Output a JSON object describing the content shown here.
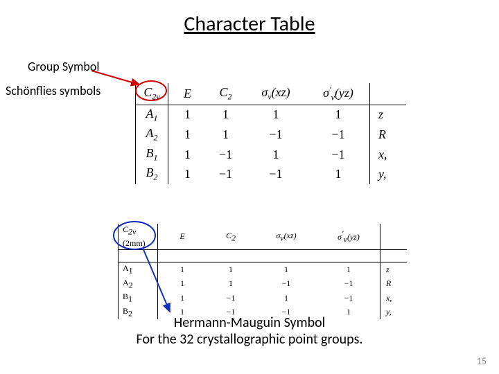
{
  "title": "Character Table",
  "labels": {
    "group_symbol": "Group Symbol",
    "schonflies": "Schönflies symbols",
    "hermann_line1": "Hermann-Mauguin Symbol",
    "hermann_line2": "For the 32 crystallographic point groups."
  },
  "top_table": {
    "header": {
      "group": "C",
      "group_sub": "2v",
      "ops": [
        "E",
        "C",
        "σ",
        "σ"
      ],
      "op_subs": [
        "",
        "2",
        "v",
        "v"
      ],
      "op_sups": [
        "",
        "",
        "",
        "′"
      ],
      "op_paren": [
        "",
        "",
        "(xz)",
        "(yz)"
      ]
    },
    "rows": [
      {
        "irrep": "A",
        "irrep_sub": "1",
        "v": [
          "1",
          "1",
          "1",
          "1"
        ],
        "basis": "z"
      },
      {
        "irrep": "A",
        "irrep_sub": "2",
        "v": [
          "1",
          "1",
          "−1",
          "−1"
        ],
        "basis": "R"
      },
      {
        "irrep": "B",
        "irrep_sub": "1",
        "v": [
          "1",
          "−1",
          "1",
          "−1"
        ],
        "basis": "x,"
      },
      {
        "irrep": "B",
        "irrep_sub": "2",
        "v": [
          "1",
          "−1",
          "−1",
          "1"
        ],
        "basis": "y,"
      }
    ]
  },
  "bottom_table": {
    "header": {
      "group1": "C",
      "group1_sub": "2v",
      "group2": "(2mm)",
      "ops": [
        "E",
        "C",
        "σ",
        "σ"
      ],
      "op_subs": [
        "",
        "2",
        "v",
        "v"
      ],
      "op_sups": [
        "",
        "",
        "",
        "′"
      ],
      "op_paren": [
        "",
        "",
        "(xz)",
        "(yz)"
      ]
    },
    "rows": [
      {
        "irrep": "A",
        "irrep_sub": "1",
        "v": [
          "1",
          "1",
          "1",
          "1"
        ],
        "basis": "z"
      },
      {
        "irrep": "A",
        "irrep_sub": "2",
        "v": [
          "1",
          "1",
          "−1",
          "−1"
        ],
        "basis": "R"
      },
      {
        "irrep": "B",
        "irrep_sub": "1",
        "v": [
          "1",
          "−1",
          "1",
          "−1"
        ],
        "basis": "x, "
      },
      {
        "irrep": "B",
        "irrep_sub": "2",
        "v": [
          "1",
          "−1",
          "−1",
          "1"
        ],
        "basis": "y, "
      }
    ]
  },
  "page_number": "15",
  "annotation_colors": {
    "red": "#d00000",
    "blue": "#1030c0"
  }
}
